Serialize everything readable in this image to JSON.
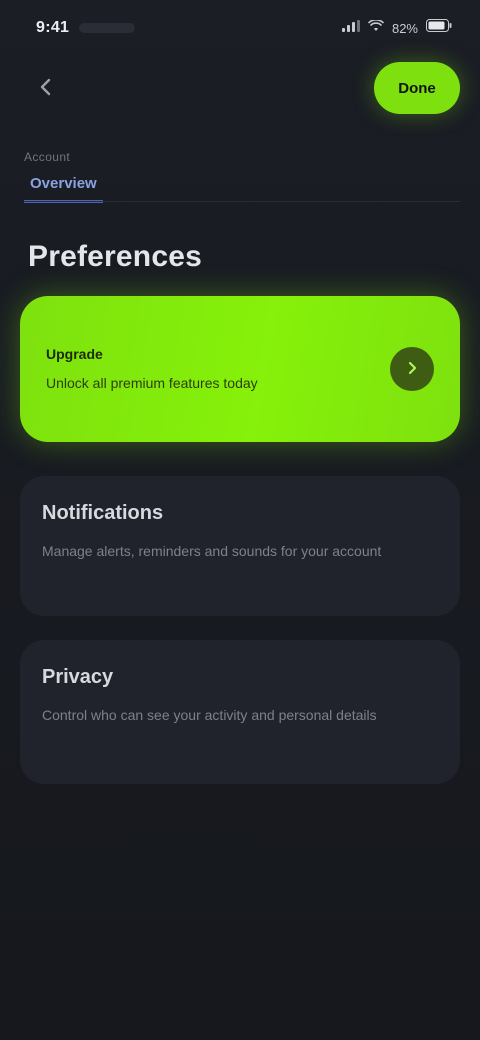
{
  "status_bar": {
    "time": "9:41",
    "battery_percent": "82%"
  },
  "top_bar": {
    "action_label": "Done"
  },
  "tabs": {
    "caption": "Account",
    "items": [
      {
        "label": "Overview",
        "active": true
      }
    ]
  },
  "section": {
    "title": "Preferences"
  },
  "hero": {
    "label": "Upgrade",
    "subtitle": "Unlock all premium features today"
  },
  "cards": [
    {
      "title": "Notifications",
      "body": "Manage alerts, reminders and sounds for your account"
    },
    {
      "title": "Privacy",
      "body": "Control who can see your activity and personal details"
    }
  ],
  "colors": {
    "accent": "#7fe00f",
    "background": "#16181d",
    "card": "#20232b",
    "tab_active": "#4b64b5"
  }
}
